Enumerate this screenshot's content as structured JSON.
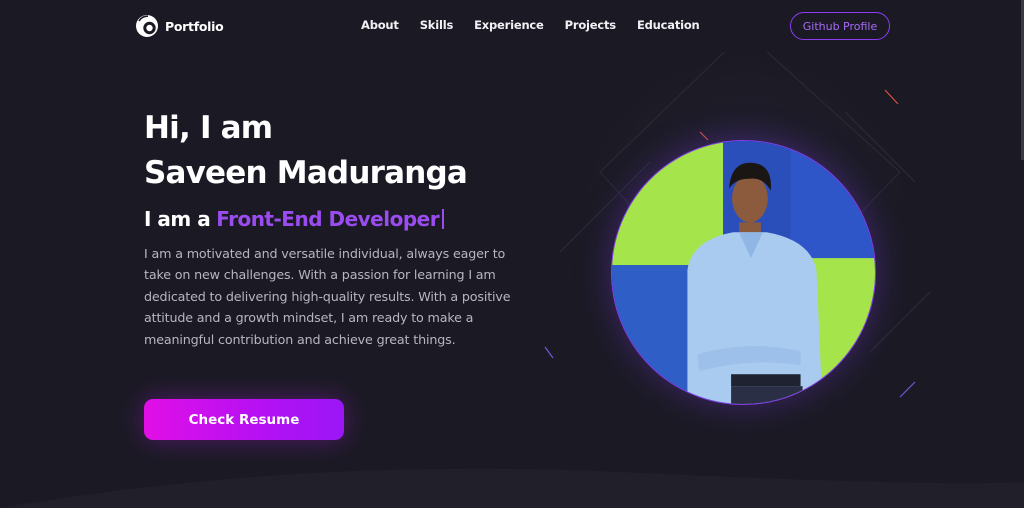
{
  "header": {
    "brand": "Portfolio",
    "brand_icon": "logo-mark-icon",
    "nav": [
      {
        "label": "About"
      },
      {
        "label": "Skills"
      },
      {
        "label": "Experience"
      },
      {
        "label": "Projects"
      },
      {
        "label": "Education"
      }
    ],
    "github_button": "Github Profile"
  },
  "hero": {
    "greeting": "Hi, I am",
    "name": "Saveen Maduranga",
    "role_prefix": "I am a",
    "role": "Front-End Developer",
    "bio": "I am a motivated and versatile individual, always eager to take on new challenges. With a passion for learning I am dedicated to delivering high-quality results. With a positive attitude and a growth mindset, I am ready to make a meaningful contribution and achieve great things.",
    "cta": "Check Resume"
  },
  "colors": {
    "background": "#1b1a24",
    "accent": "#8a3cf0",
    "cta_gradient_start": "#e10fe6",
    "cta_gradient_end": "#9b16f6",
    "text_muted": "#b7b6c0"
  }
}
